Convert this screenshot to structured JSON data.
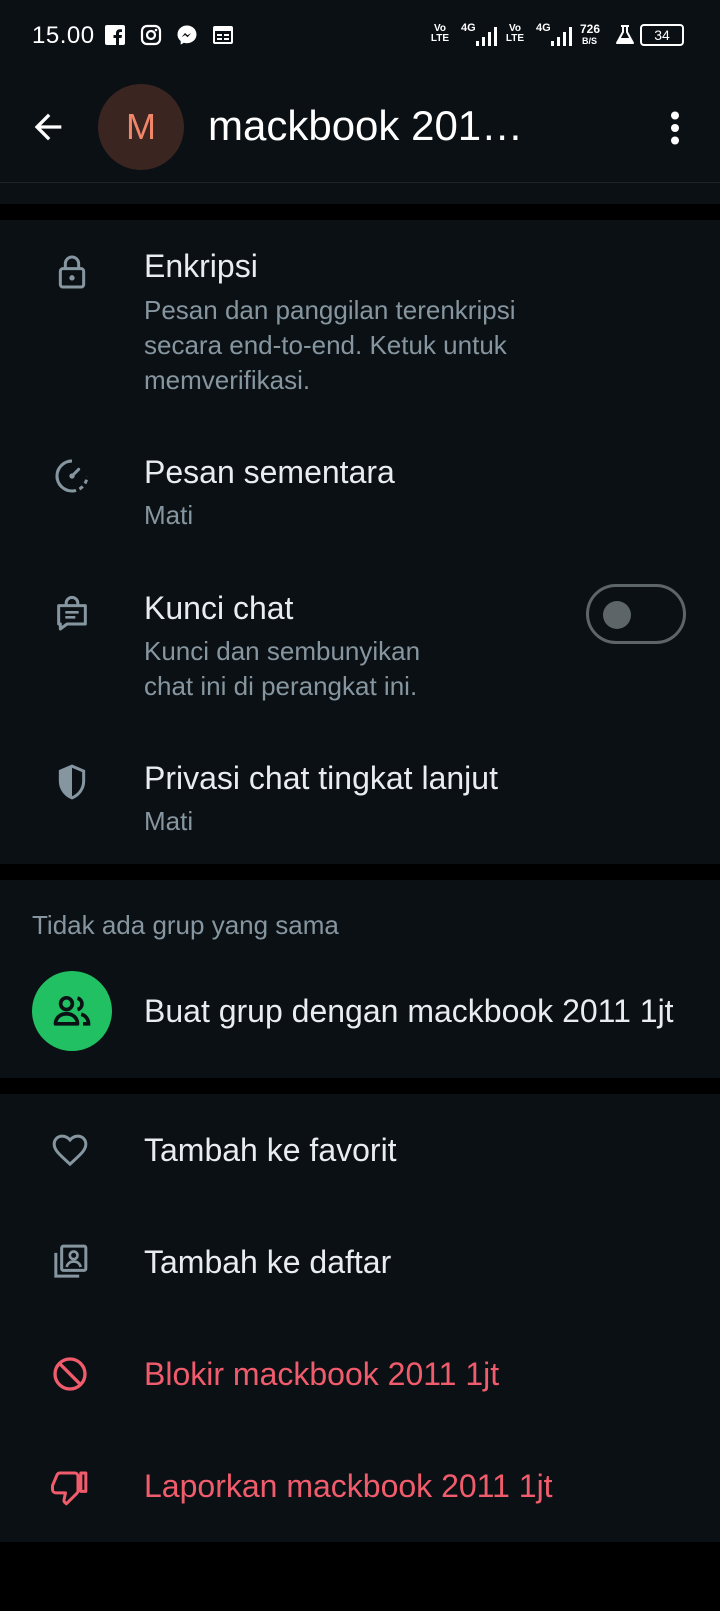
{
  "status_bar": {
    "time": "15.00",
    "left_icons": [
      "facebook-icon",
      "instagram-icon",
      "messenger-icon",
      "calendar-icon"
    ],
    "net1": "Vo LTE",
    "net1_gen": "4G",
    "net2": "Vo LTE",
    "net2_gen": "4G",
    "speed_value": "726",
    "speed_unit": "B/S",
    "battery": "34"
  },
  "header": {
    "avatar_letter": "M",
    "title": "mackbook 201…"
  },
  "security": {
    "encryption_title": "Enkripsi",
    "encryption_sub": "Pesan dan panggilan terenkripsi secara end-to-end. Ketuk untuk memverifikasi.",
    "disappearing_title": "Pesan sementara",
    "disappearing_sub": "Mati",
    "lock_title": "Kunci chat",
    "lock_sub_line1": "Kunci dan sembunyikan",
    "lock_sub_line2": "chat ini di perangkat ini.",
    "lock_toggle_on": false,
    "privacy_title": "Privasi chat tingkat lanjut",
    "privacy_sub": "Mati"
  },
  "groups": {
    "label": "Tidak ada grup yang sama",
    "create_label": "Buat grup dengan mackbook 2011 1jt"
  },
  "actions": {
    "favorite": "Tambah ke favorit",
    "list": "Tambah ke daftar",
    "block": "Blokir mackbook 2011 1jt",
    "report": "Laporkan mackbook 2011 1jt"
  },
  "colors": {
    "background": "#0b1014",
    "accent_green": "#21c063",
    "danger": "#f15c6d",
    "secondary_text": "#8696a0"
  }
}
